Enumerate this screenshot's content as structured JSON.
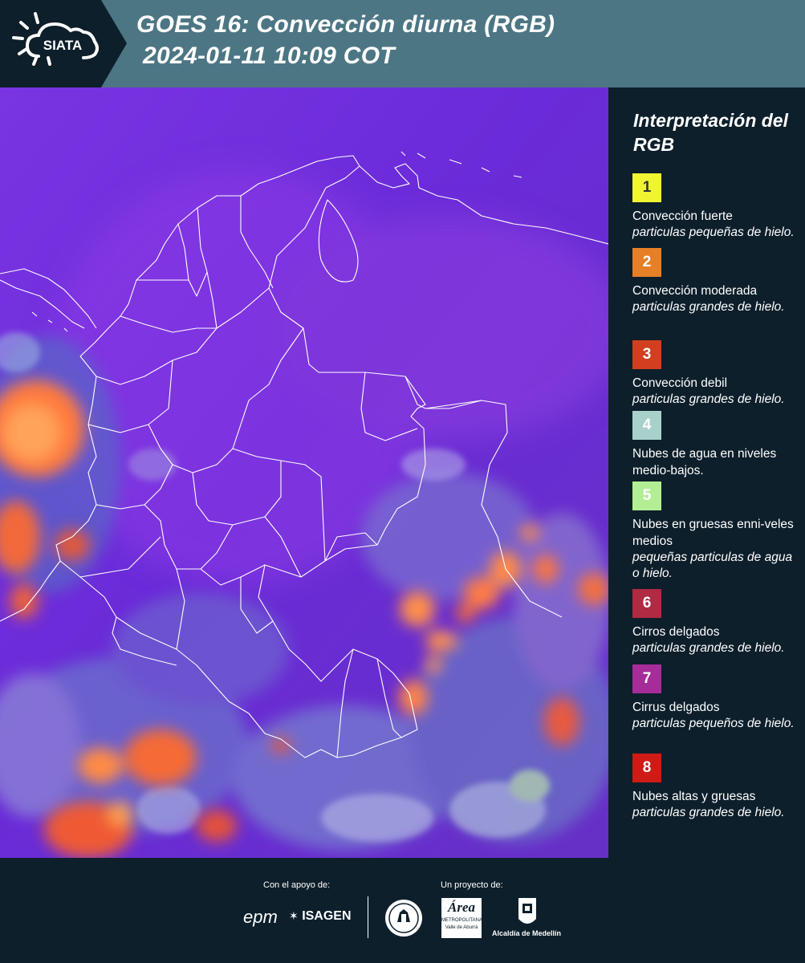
{
  "header": {
    "logo_text": "SIATA",
    "title_line1": "GOES 16: Convección diurna (RGB)",
    "title_line2": "2024-01-11 10:09 COT",
    "background_color": "#4d7684"
  },
  "legend": {
    "title": "Interpretación del RGB",
    "items": [
      {
        "number": "1",
        "color": "#f0f531",
        "number_color": "#333333",
        "main": "Convección fuerte",
        "sub": "particulas pequeñas de hielo."
      },
      {
        "number": "2",
        "color": "#e77f27",
        "number_color": "#ffffff",
        "main": "Convección moderada",
        "sub": "particulas grandes de hielo."
      },
      {
        "number": "3",
        "color": "#d23f1f",
        "number_color": "#ffffff",
        "main": "Convección debil",
        "sub": "particulas grandes de hielo."
      },
      {
        "number": "4",
        "color": "#a9d1cc",
        "number_color": "#ffffff",
        "main": "Nubes de agua en niveles medio-bajos.",
        "sub": ""
      },
      {
        "number": "5",
        "color": "#b3ee95",
        "number_color": "#ffffff",
        "main": "Nubes en gruesas enni-veles medios",
        "sub": "pequeñas particulas de agua o hielo."
      },
      {
        "number": "6",
        "color": "#b02a43",
        "number_color": "#ffffff",
        "main": "Cirros delgados",
        "sub": "particulas grandes de hielo."
      },
      {
        "number": "7",
        "color": "#a52c99",
        "number_color": "#ffffff",
        "main": "Cirrus delgados",
        "sub": "particulas pequeños de hielo."
      },
      {
        "number": "8",
        "color": "#cf1b16",
        "number_color": "#ffffff",
        "main": "Nubes altas y gruesas",
        "sub": "particulas grandes de hielo."
      }
    ]
  },
  "footer": {
    "support_caption": "Con el apoyo de:",
    "project_caption": "Un proyecto de:",
    "sponsor_epm": "epm",
    "sponsor_isagen": "ISAGEN",
    "area_metro_lines": [
      "Área",
      "METROPOLITANA",
      "Valle de Aburrá"
    ],
    "alcaldia": "Alcaldía de Medellín"
  },
  "map": {
    "base_color": "#6a2bd8",
    "border_color": "#ffffff"
  }
}
